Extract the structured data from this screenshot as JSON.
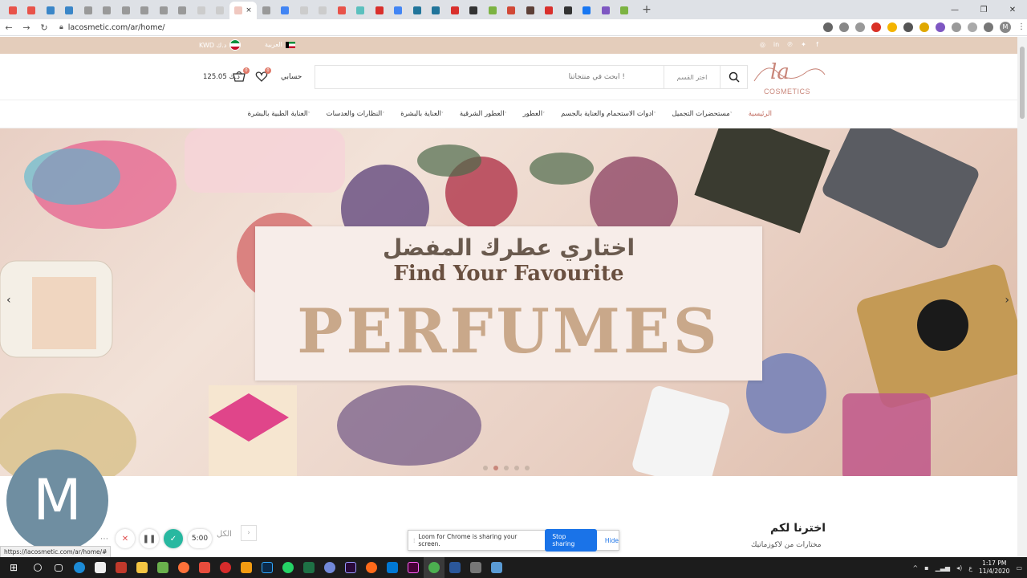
{
  "browser": {
    "active_tab_close": "×",
    "new_tab": "+",
    "url": "lacosmetic.com/ar/home/",
    "profile_initial": "M",
    "status_url": "https://lacosmetic.com/ar/home/#"
  },
  "site": {
    "logo_script": "la",
    "logo_text": "COSMETICS",
    "language": "العربية",
    "currency": "KWD د.ك",
    "search_placeholder": "أبحث في منتجاتنا !",
    "category_select": "اختر القسم",
    "account": "حسابي",
    "wishlist_count": "0",
    "cart_count": "0",
    "cart_total": "125.05 د.ك",
    "nav": [
      {
        "label": "الرئيسية"
      },
      {
        "label": "مستحضرات التجميل"
      },
      {
        "label": "ادوات الاستحمام والعناية بالجسم"
      },
      {
        "label": "العطور"
      },
      {
        "label": "العطور الشرقية"
      },
      {
        "label": "العناية بالبشرة"
      },
      {
        "label": "النظارات والعدسات"
      },
      {
        "label": "العناية الطبية بالبشرة"
      }
    ]
  },
  "hero": {
    "title_ar": "اختاري عطرك المفضل",
    "title_en": "Find Your Favourite",
    "title_big": "PERFUMES",
    "active_slide": 2,
    "slide_count": 5
  },
  "section": {
    "title": "اخترنا لكم",
    "subtitle": "مختارات من لاكوزماتيك",
    "all_link": "الكل"
  },
  "loom": {
    "avatar_letter": "M",
    "timer": "5:00",
    "share_text": "Loom for Chrome is sharing your screen.",
    "stop_label": "Stop sharing",
    "hide_label": "Hide"
  },
  "taskbar": {
    "time": "1:17 PM",
    "date": "11/4/2020",
    "lang": "ع"
  },
  "colors": {
    "topbar": "#e4cdbb",
    "accent": "#c06a5e",
    "stop_button": "#1a73e8"
  }
}
